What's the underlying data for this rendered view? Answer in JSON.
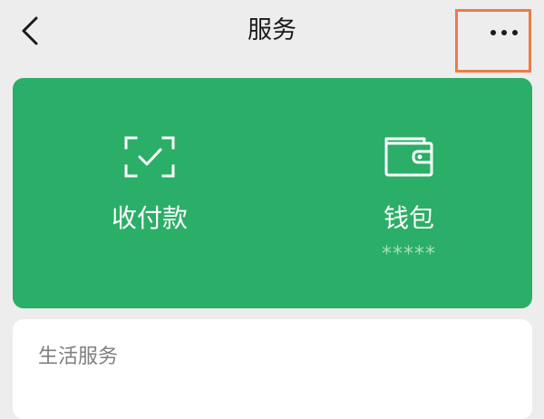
{
  "header": {
    "title": "服务",
    "back_icon": "chevron-left-icon",
    "more_icon": "more-horizontal-icon",
    "highlight_color": "#f07a45"
  },
  "services": {
    "background_color": "#2bae67",
    "pay": {
      "label": "收付款",
      "icon": "scan-check-icon"
    },
    "wallet": {
      "label": "钱包",
      "balance_masked": "*****",
      "icon": "wallet-icon"
    }
  },
  "life_services": {
    "title": "生活服务"
  }
}
